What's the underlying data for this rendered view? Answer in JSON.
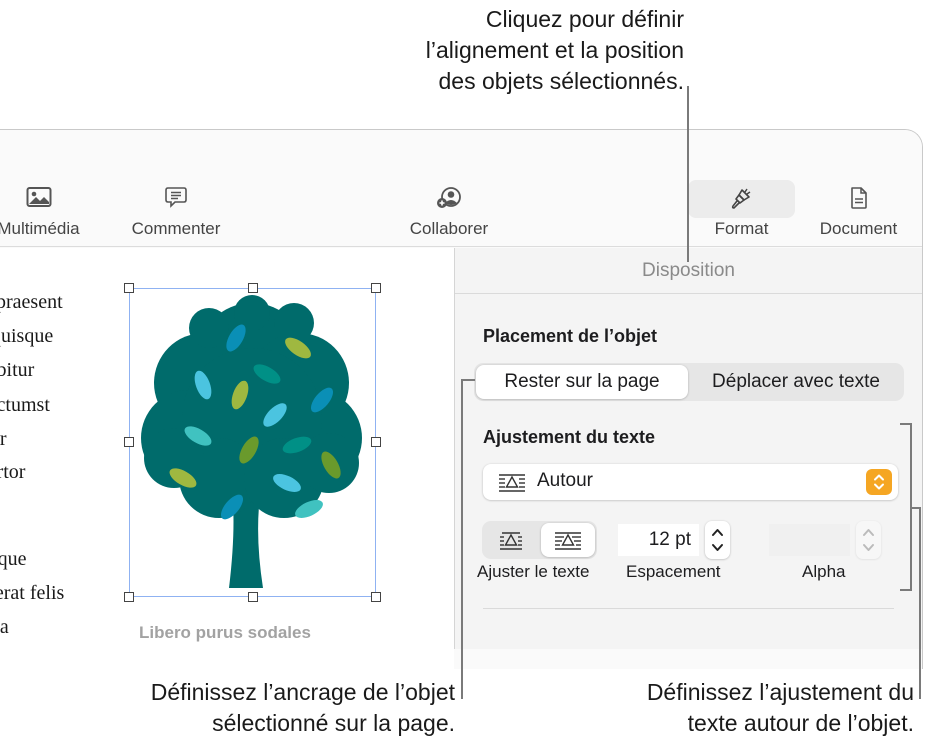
{
  "callouts": {
    "top": [
      "Cliquez pour définir",
      "l’alignement et la position",
      "des objets sélectionnés."
    ],
    "bottom_left": [
      "Définissez l’ancrage de l’objet",
      "sélectionné sur la page."
    ],
    "bottom_right": [
      "Définissez l’ajustement du",
      "texte autour de l’objet."
    ]
  },
  "toolbar": {
    "media": {
      "label": "Multimédia",
      "icon": "photo-icon"
    },
    "comment": {
      "label": "Commenter",
      "icon": "comment-icon"
    },
    "collaborate": {
      "label": "Collaborer",
      "icon": "collaborate-icon"
    },
    "format": {
      "label": "Format",
      "icon": "paintbrush-icon",
      "active": true
    },
    "document": {
      "label": "Document",
      "icon": "document-icon"
    }
  },
  "document": {
    "lines": [
      "d praesent",
      ". quisque",
      "rabitur",
      "dictumst",
      "per",
      "tortor",
      "",
      "esque",
      "a erat felis",
      "ada"
    ],
    "image_caption": "Libero purus sodales"
  },
  "inspector": {
    "tab_title": "Disposition",
    "placement": {
      "title": "Placement de l’objet",
      "options": [
        "Rester sur la page",
        "Déplacer avec texte"
      ],
      "selected": "Rester sur la page"
    },
    "text_wrap": {
      "title": "Ajustement du texte",
      "popup_value": "Autour",
      "fit_label": "Ajuster le texte",
      "fit_selected_index": 1,
      "spacing_label": "Espacement",
      "spacing_value": "12 pt",
      "alpha_label": "Alpha",
      "alpha_value": ""
    }
  },
  "colors": {
    "accent_orange": "#f5a623",
    "selection_blue": "#8fb2f2",
    "tree_dark": "#006b6b"
  }
}
